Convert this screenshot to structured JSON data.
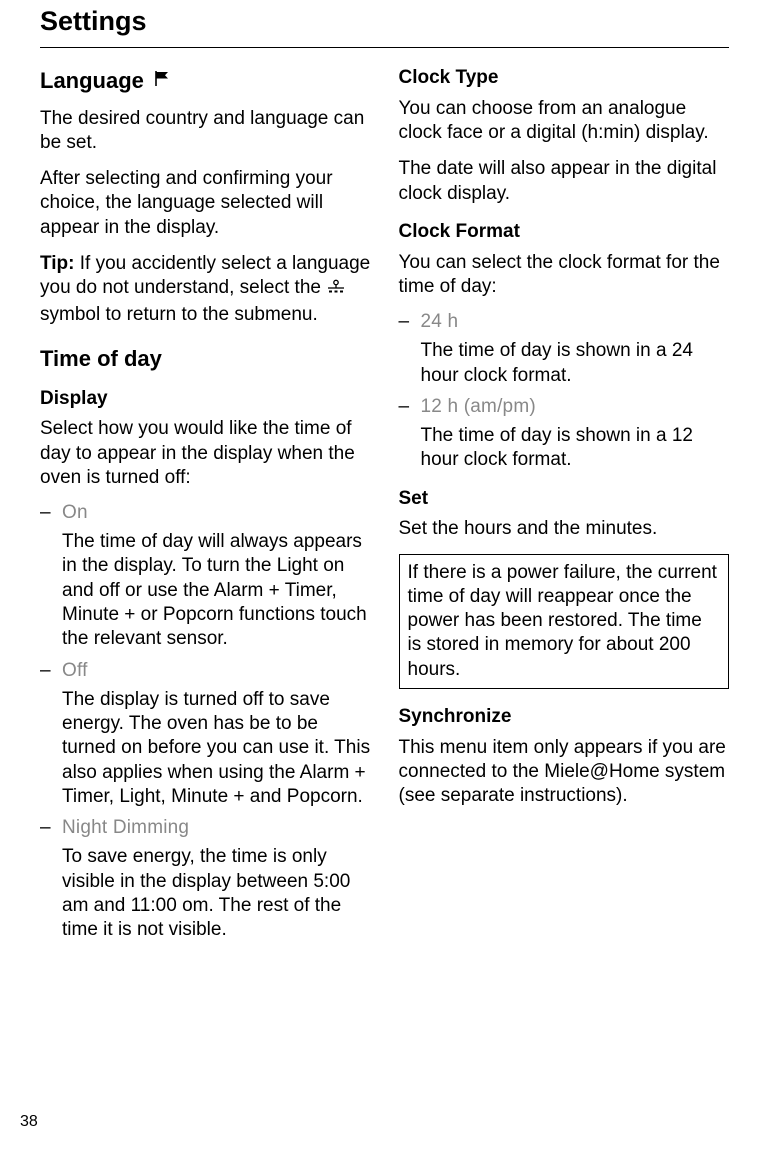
{
  "page_title": "Settings",
  "page_number": "38",
  "left": {
    "language": {
      "heading": "Language",
      "flag_icon_name": "flag-icon",
      "p1": "The desired country and language can be set.",
      "p2": "After selecting and confirming your choice, the language selected will appear in the display.",
      "tip_label": "Tip:",
      "tip_before": " If you accidently select a language you do not understand, select the ",
      "tip_after": " symbol to return to the submenu.",
      "menu_icon_name": "menu-symbol-icon"
    },
    "time_of_day": {
      "heading": "Time of day",
      "display_heading": "Display",
      "display_intro": "Select how you would like the time of day to appear in the display when the oven is turned off:",
      "options": [
        {
          "label": "On",
          "desc": "The time of day will always appears in the display. To turn the Light on and off or use the Alarm + Timer, Minute + or Popcorn functions touch the relevant sensor."
        },
        {
          "label": "Off",
          "desc": "The display is turned off to save energy. The oven has be to be turned on before you can use it. This also applies when using the Alarm + Timer, Light, Minute + and Popcorn."
        },
        {
          "label": "Night Dimming",
          "desc": "To save energy, the time is only visible in the display between 5:00 am and 11:00 om. The rest of the time it is not visible."
        }
      ]
    }
  },
  "right": {
    "clock_type": {
      "heading": "Clock Type",
      "p1": "You can choose from an analogue clock face or a digital (h:min) display.",
      "p2": "The date will also appear in the digital clock display."
    },
    "clock_format": {
      "heading": "Clock Format",
      "intro": "You can select the clock format for the time of day:",
      "options": [
        {
          "label": "24 h",
          "desc": "The time of day is shown in a 24 hour clock format."
        },
        {
          "label": "12 h (am/pm)",
          "desc": "The time of day is shown in a 12 hour clock format."
        }
      ]
    },
    "set": {
      "heading": "Set",
      "p1": "Set the hours and the minutes.",
      "note": "If there is a power failure, the current time of day will reappear once the power has been restored. The time is stored in memory for about 200 hours."
    },
    "synchronize": {
      "heading": "Synchronize",
      "p1": "This menu item only appears if you are connected to the Miele@Home system (see separate instructions)."
    }
  }
}
